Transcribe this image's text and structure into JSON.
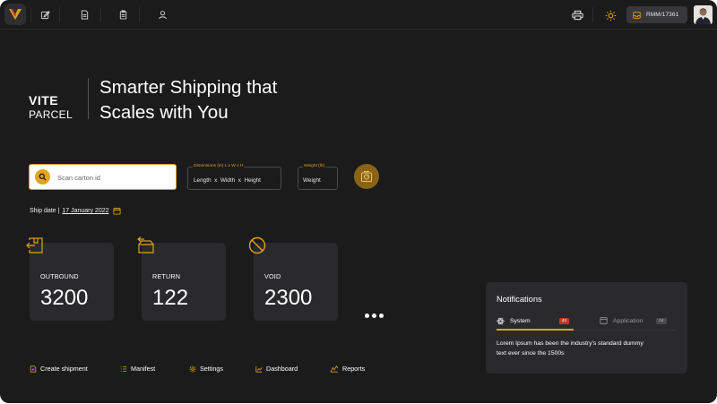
{
  "app": {
    "brand": {
      "line1": "VITE",
      "line2": "PARCEL"
    },
    "tagline": "Smarter Shipping that Scales with You",
    "accent_color": "#e0a11b"
  },
  "topbar": {
    "nav_icons": [
      "edit-icon",
      "document-icon",
      "clipboard-icon",
      "user-icon"
    ],
    "right_icons": [
      "printer-icon",
      "sun-icon"
    ],
    "user_id": "RMM/17361"
  },
  "scan": {
    "placeholder": "Scan carton id",
    "dimensions_label": "Dimensions (in) L x W x H",
    "dimensions_value": "Length  x  Width  x  Height",
    "weight_label": "Weight (lb)",
    "weight_value": "Weight"
  },
  "ship_date": {
    "label": "Ship date |",
    "date": "17 January 2022"
  },
  "stats": [
    {
      "label": "OUTBOUND",
      "value": "3200"
    },
    {
      "label": "RETURN",
      "value": "122"
    },
    {
      "label": "VOID",
      "value": "2300"
    }
  ],
  "menu": [
    {
      "label": "Create shipment",
      "icon": "create-shipment-icon"
    },
    {
      "label": "Manifest",
      "icon": "list-icon"
    },
    {
      "label": "Settings",
      "icon": "gear-icon"
    },
    {
      "label": "Dashboard",
      "icon": "chart-icon"
    },
    {
      "label": "Reports",
      "icon": "reports-icon"
    }
  ],
  "notifications": {
    "title": "Notifications",
    "tabs": [
      {
        "label": "System",
        "count": "42",
        "badge_color": "#c0392b",
        "active": true
      },
      {
        "label": "Application",
        "count": "04",
        "badge_color": "#4a4a4c",
        "active": false
      }
    ],
    "message": "Lorem Ipsum has been the industry's standard dummy text ever since the 1500s"
  }
}
